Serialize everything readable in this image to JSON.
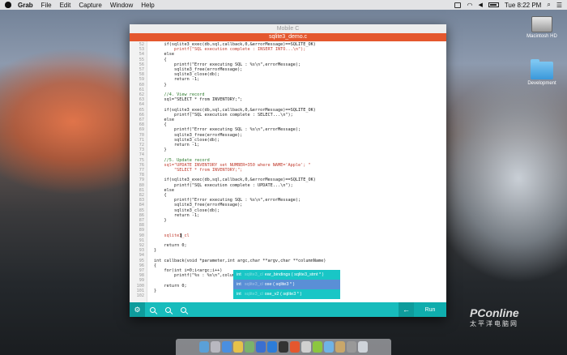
{
  "menubar": {
    "app": "Grab",
    "menus": [
      "File",
      "Edit",
      "Capture",
      "Window",
      "Help"
    ],
    "clock": "Tue 8:22 PM"
  },
  "desktop": {
    "icons": [
      "Macintosh HD",
      "Development"
    ]
  },
  "window": {
    "title": "Mobile C",
    "tab": "sqlite3_demo.c"
  },
  "editor": {
    "lines": [
      {
        "n": "52",
        "code": "    if(sqlite3_exec(db,sql,callback,0,&errorMessage)==SQLITE_OK)",
        "kind": ""
      },
      {
        "n": "53",
        "code": "        printf(\"SQL execution complete : INSERT INTO...\\n\");",
        "kind": "str"
      },
      {
        "n": "54",
        "code": "    else",
        "kind": ""
      },
      {
        "n": "55",
        "code": "    {",
        "kind": ""
      },
      {
        "n": "56",
        "code": "        printf(\"Error executing SQL : %s\\n\",errorMessage);",
        "kind": ""
      },
      {
        "n": "57",
        "code": "        sqlite3_free(errorMessage);",
        "kind": ""
      },
      {
        "n": "58",
        "code": "        sqlite3_close(db);",
        "kind": ""
      },
      {
        "n": "59",
        "code": "        return -1;",
        "kind": ""
      },
      {
        "n": "60",
        "code": "    }",
        "kind": ""
      },
      {
        "n": "61",
        "code": "",
        "kind": ""
      },
      {
        "n": "62",
        "code": "    //4. View record",
        "kind": "cmt"
      },
      {
        "n": "63",
        "code": "    sql=\"SELECT * from INVENTORY;\";",
        "kind": ""
      },
      {
        "n": "64",
        "code": "",
        "kind": ""
      },
      {
        "n": "65",
        "code": "    if(sqlite3_exec(db,sql,callback,0,&errorMessage)==SQLITE_OK)",
        "kind": ""
      },
      {
        "n": "66",
        "code": "        printf(\"SQL execution complete : SELECT...\\n\");",
        "kind": ""
      },
      {
        "n": "67",
        "code": "    else",
        "kind": ""
      },
      {
        "n": "68",
        "code": "    {",
        "kind": ""
      },
      {
        "n": "69",
        "code": "        printf(\"Error executing SQL : %s\\n\",errorMessage);",
        "kind": ""
      },
      {
        "n": "70",
        "code": "        sqlite3_free(errorMessage);",
        "kind": ""
      },
      {
        "n": "71",
        "code": "        sqlite3_close(db);",
        "kind": ""
      },
      {
        "n": "72",
        "code": "        return -1;",
        "kind": ""
      },
      {
        "n": "73",
        "code": "    }",
        "kind": ""
      },
      {
        "n": "74",
        "code": "",
        "kind": ""
      },
      {
        "n": "75",
        "code": "    //5. Update record",
        "kind": "cmt"
      },
      {
        "n": "76",
        "code": "    sql=\"UPDATE INVENTORY set NUMBER=350 where NAME='Apple'; \"",
        "kind": "str"
      },
      {
        "n": "77",
        "code": "        \"SELECT * from INVENTORY;\";",
        "kind": "str"
      },
      {
        "n": "78",
        "code": "",
        "kind": ""
      },
      {
        "n": "79",
        "code": "    if(sqlite3_exec(db,sql,callback,0,&errorMessage)==SQLITE_OK)",
        "kind": ""
      },
      {
        "n": "80",
        "code": "        printf(\"SQL execution complete : UPDATE...\\n\");",
        "kind": ""
      },
      {
        "n": "81",
        "code": "    else",
        "kind": ""
      },
      {
        "n": "82",
        "code": "    {",
        "kind": ""
      },
      {
        "n": "83",
        "code": "        printf(\"Error executing SQL : %s\\n\",errorMessage);",
        "kind": ""
      },
      {
        "n": "84",
        "code": "        sqlite3_free(errorMessage);",
        "kind": ""
      },
      {
        "n": "85",
        "code": "        sqlite3_close(db);",
        "kind": ""
      },
      {
        "n": "86",
        "code": "        return -1;",
        "kind": ""
      },
      {
        "n": "87",
        "code": "    }",
        "kind": ""
      },
      {
        "n": "88",
        "code": "",
        "kind": ""
      },
      {
        "n": "89",
        "code": "",
        "kind": ""
      },
      {
        "n": "90",
        "code": "    sqlite3_cl",
        "kind": "cur"
      },
      {
        "n": "91",
        "code": "",
        "kind": ""
      },
      {
        "n": "92",
        "code": "    return 0;",
        "kind": ""
      },
      {
        "n": "93",
        "code": "}",
        "kind": ""
      },
      {
        "n": "94",
        "code": "",
        "kind": ""
      },
      {
        "n": "95",
        "code": "int callback(void *parameter,int argc,char **argv,char **columnName)",
        "kind": ""
      },
      {
        "n": "96",
        "code": "{",
        "kind": ""
      },
      {
        "n": "97",
        "code": "    for(int i=0;i<argc;i++)",
        "kind": ""
      },
      {
        "n": "98",
        "code": "        printf(\"%s : %s\\n\",columnName[",
        "kind": ""
      },
      {
        "n": "99",
        "code": "",
        "kind": ""
      },
      {
        "n": "100",
        "code": "    return 0;",
        "kind": ""
      },
      {
        "n": "101",
        "code": "}",
        "kind": ""
      },
      {
        "n": "102",
        "code": "",
        "kind": ""
      }
    ]
  },
  "autocomplete": {
    "items": [
      {
        "type": "int",
        "faded": "sqlite3_cl",
        "text": "ear_bindings ( sqlite3_stmt * )",
        "selected": false
      },
      {
        "type": "int",
        "faded": "sqlite3_cl",
        "text": "ose ( sqlite3 * )",
        "selected": true
      },
      {
        "type": "int",
        "faded": "sqlite3_cl",
        "text": "ose_v2 ( sqlite3 * )",
        "selected": false
      }
    ]
  },
  "toolbar": {
    "settings_icon": "gear-icon",
    "zoom_in_icon": "zoom-in-icon",
    "zoom_out_icon": "zoom-out-icon",
    "search_icon": "search-icon",
    "back_icon": "arrow-left-icon",
    "run_label": "Run",
    "accent": "#17bcbc"
  },
  "watermark": {
    "brand": "PConline",
    "sub": "太平洋电脑网"
  }
}
